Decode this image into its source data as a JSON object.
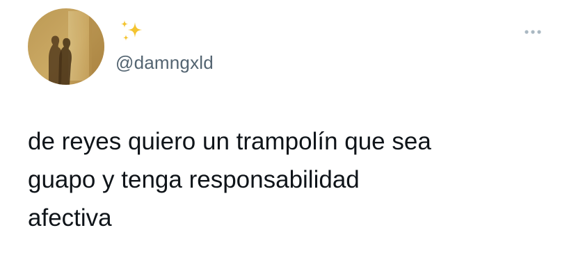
{
  "tweet": {
    "author": {
      "avatar_icon": "profile-photo",
      "display_name_icon": "sparkles-emoji",
      "handle": "@damngxld"
    },
    "more_icon": "more-dots-icon",
    "text": "de reyes quiero un trampolín que sea\nguapo y tenga responsabilidad\nafectiva"
  },
  "colors": {
    "text": "#0f1419",
    "secondary_text": "#536471",
    "sparkle": "#f4c430",
    "more_dots": "#aab8c2"
  }
}
